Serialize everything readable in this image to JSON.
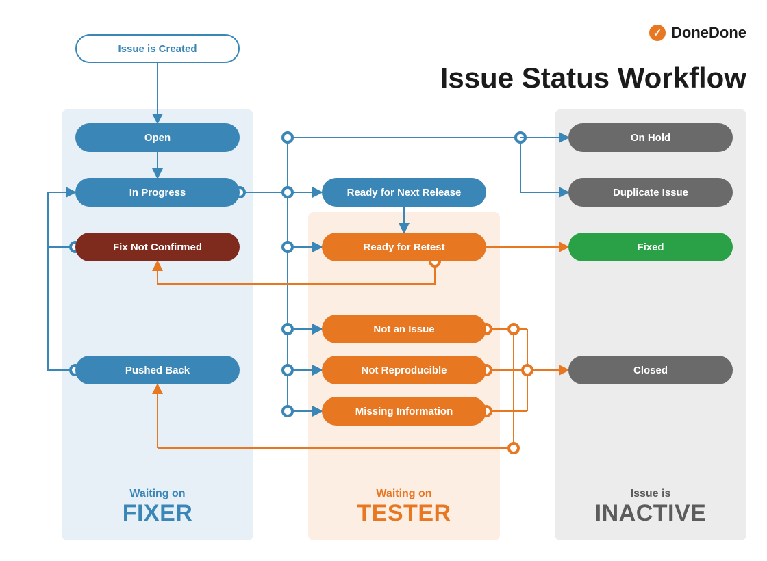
{
  "brand": {
    "name": "DoneDone",
    "badge_glyph": "✓"
  },
  "title": "Issue Status Workflow",
  "columns": {
    "fixer": {
      "line1": "Waiting on",
      "line2": "FIXER"
    },
    "tester": {
      "line1": "Waiting on",
      "line2": "TESTER"
    },
    "inactive": {
      "line1": "Issue is",
      "line2": "INACTIVE"
    }
  },
  "nodes": {
    "start": "Issue is Created",
    "open": "Open",
    "in_progress": "In Progress",
    "fix_not_confirmed": "Fix Not Confirmed",
    "pushed_back": "Pushed Back",
    "ready_release": "Ready for Next Release",
    "ready_retest": "Ready for Retest",
    "not_issue": "Not an Issue",
    "not_repro": "Not Reproducible",
    "missing_info": "Missing Information",
    "on_hold": "On Hold",
    "duplicate": "Duplicate Issue",
    "fixed": "Fixed",
    "closed": "Closed"
  },
  "colors": {
    "blue": "#3a87b7",
    "orange": "#e87722"
  },
  "chart_data": {
    "type": "flowchart",
    "title": "Issue Status Workflow",
    "lanes": [
      {
        "id": "fixer",
        "label": "Waiting on FIXER",
        "states": [
          "open",
          "in_progress",
          "fix_not_confirmed",
          "pushed_back"
        ]
      },
      {
        "id": "tester",
        "label": "Waiting on TESTER",
        "states": [
          "ready_retest",
          "not_issue",
          "not_repro",
          "missing_info"
        ]
      },
      {
        "id": "inactive",
        "label": "Issue is INACTIVE",
        "states": [
          "on_hold",
          "duplicate",
          "fixed",
          "closed"
        ]
      }
    ],
    "extra_states": [
      {
        "id": "start",
        "label": "Issue is Created"
      },
      {
        "id": "ready_release",
        "label": "Ready for Next Release"
      }
    ],
    "edges": [
      {
        "from": "start",
        "to": "open"
      },
      {
        "from": "open",
        "to": "in_progress"
      },
      {
        "from": "in_progress",
        "to": "on_hold"
      },
      {
        "from": "in_progress",
        "to": "duplicate"
      },
      {
        "from": "in_progress",
        "to": "ready_release"
      },
      {
        "from": "in_progress",
        "to": "ready_retest"
      },
      {
        "from": "in_progress",
        "to": "not_issue"
      },
      {
        "from": "in_progress",
        "to": "not_repro"
      },
      {
        "from": "in_progress",
        "to": "missing_info"
      },
      {
        "from": "ready_release",
        "to": "ready_retest"
      },
      {
        "from": "ready_retest",
        "to": "fixed"
      },
      {
        "from": "ready_retest",
        "to": "fix_not_confirmed"
      },
      {
        "from": "fix_not_confirmed",
        "to": "in_progress"
      },
      {
        "from": "pushed_back",
        "to": "in_progress"
      },
      {
        "from": "not_issue",
        "to": "closed"
      },
      {
        "from": "not_repro",
        "to": "closed"
      },
      {
        "from": "missing_info",
        "to": "closed"
      },
      {
        "from": "not_issue",
        "to": "pushed_back"
      },
      {
        "from": "not_repro",
        "to": "pushed_back"
      },
      {
        "from": "missing_info",
        "to": "pushed_back"
      }
    ]
  }
}
